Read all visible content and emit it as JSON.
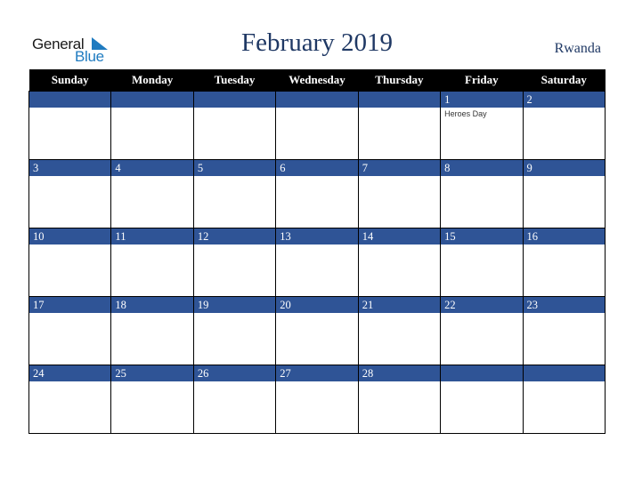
{
  "logo": {
    "line1": "General",
    "line2": "Blue"
  },
  "title": "February 2019",
  "country": "Rwanda",
  "colors": {
    "header_bg": "#000000",
    "day_bar": "#2f5496",
    "title": "#1f3864",
    "logo_blue": "#1f7bc0"
  },
  "weekdays": [
    "Sunday",
    "Monday",
    "Tuesday",
    "Wednesday",
    "Thursday",
    "Friday",
    "Saturday"
  ],
  "weeks": [
    [
      {
        "day": ""
      },
      {
        "day": ""
      },
      {
        "day": ""
      },
      {
        "day": ""
      },
      {
        "day": ""
      },
      {
        "day": "1",
        "event": "Heroes Day"
      },
      {
        "day": "2"
      }
    ],
    [
      {
        "day": "3"
      },
      {
        "day": "4"
      },
      {
        "day": "5"
      },
      {
        "day": "6"
      },
      {
        "day": "7"
      },
      {
        "day": "8"
      },
      {
        "day": "9"
      }
    ],
    [
      {
        "day": "10"
      },
      {
        "day": "11"
      },
      {
        "day": "12"
      },
      {
        "day": "13"
      },
      {
        "day": "14"
      },
      {
        "day": "15"
      },
      {
        "day": "16"
      }
    ],
    [
      {
        "day": "17"
      },
      {
        "day": "18"
      },
      {
        "day": "19"
      },
      {
        "day": "20"
      },
      {
        "day": "21"
      },
      {
        "day": "22"
      },
      {
        "day": "23"
      }
    ],
    [
      {
        "day": "24"
      },
      {
        "day": "25"
      },
      {
        "day": "26"
      },
      {
        "day": "27"
      },
      {
        "day": "28"
      },
      {
        "day": ""
      },
      {
        "day": ""
      }
    ]
  ]
}
